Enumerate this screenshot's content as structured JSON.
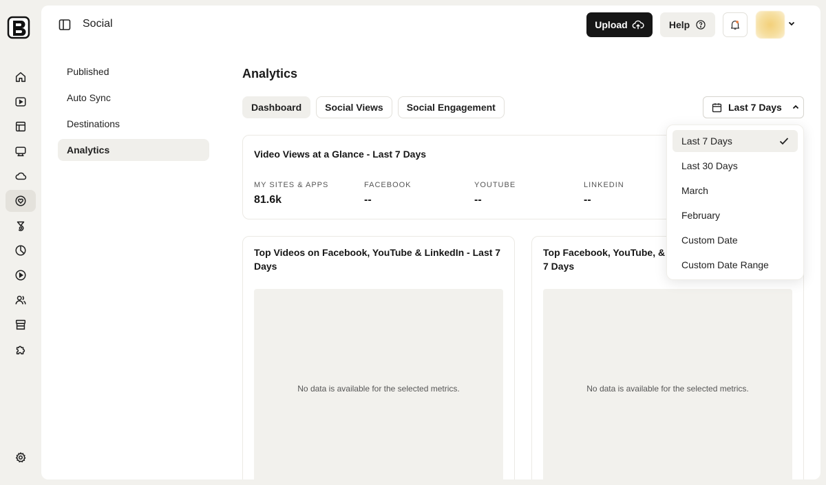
{
  "topbar": {
    "title": "Social",
    "upload_label": "Upload",
    "help_label": "Help"
  },
  "rail": {
    "items": [
      "home-icon",
      "video-play-icon",
      "layout-icon",
      "monitor-icon",
      "cloud-icon",
      "social-heart-icon",
      "flow-icon",
      "analytics-pie-icon",
      "play-circle-icon",
      "users-icon",
      "store-icon",
      "puzzle-icon",
      "settings-gear-icon"
    ],
    "active_item": "social-heart-icon"
  },
  "subnav": {
    "items": [
      {
        "label": "Published"
      },
      {
        "label": "Auto Sync"
      },
      {
        "label": "Destinations"
      },
      {
        "label": "Analytics"
      }
    ],
    "active": "Analytics"
  },
  "page": {
    "title": "Analytics",
    "tabs": [
      {
        "label": "Dashboard"
      },
      {
        "label": "Social Views"
      },
      {
        "label": "Social Engagement"
      }
    ],
    "active_tab": "Dashboard",
    "date_range": "Last 7 Days"
  },
  "glance": {
    "title": "Video Views at a Glance - Last 7 Days",
    "metrics": [
      {
        "label": "MY SITES & APPS",
        "value": "81.6k"
      },
      {
        "label": "FACEBOOK",
        "value": "--"
      },
      {
        "label": "YOUTUBE",
        "value": "--"
      },
      {
        "label": "LINKEDIN",
        "value": "--"
      }
    ]
  },
  "cards": [
    {
      "title": "Top Videos on Facebook, YouTube & LinkedIn - Last 7 Days",
      "empty_text": "No data is available for the selected metrics."
    },
    {
      "title": "Top Facebook, YouTube, & L",
      "title_line2": "7 Days",
      "empty_text": "No data is available for the selected metrics."
    }
  ],
  "dropdown": {
    "options": [
      {
        "label": "Last 7 Days"
      },
      {
        "label": "Last 30 Days"
      },
      {
        "label": "March"
      },
      {
        "label": "February"
      },
      {
        "label": "Custom Date"
      },
      {
        "label": "Custom Date Range"
      }
    ],
    "selected": "Last 7 Days"
  },
  "colors": {
    "background": "#f2f1ed",
    "panel": "#ffffff",
    "primary_button": "#161616",
    "active_item": "#f0efeb"
  }
}
